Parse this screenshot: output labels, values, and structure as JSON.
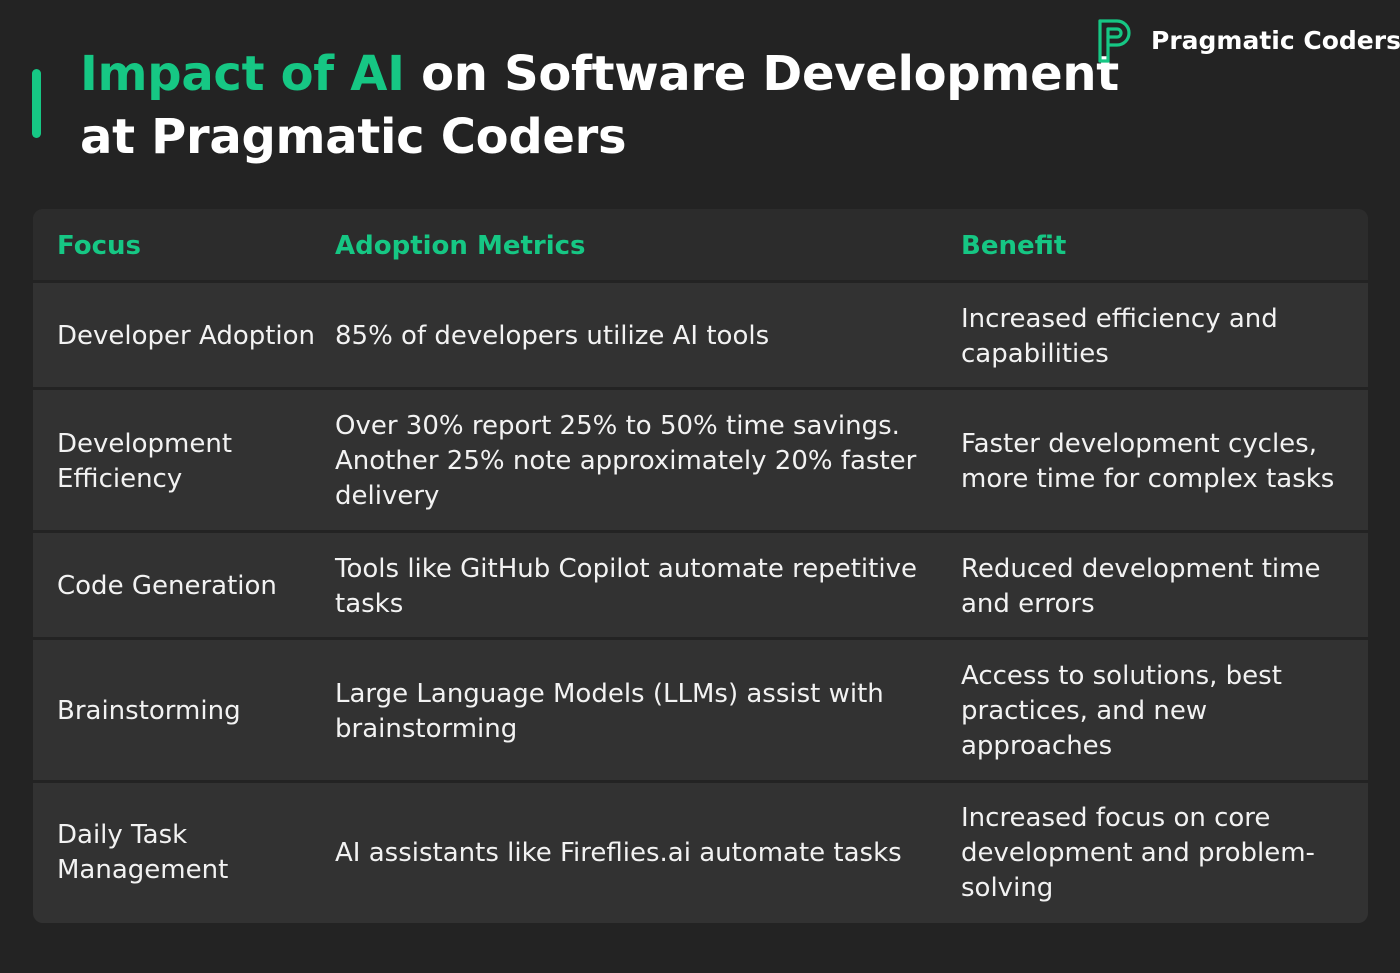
{
  "brand": {
    "name": "Pragmatic Coders",
    "logo_icon": "pc-logo-icon",
    "accent_color": "#16c784"
  },
  "title": {
    "highlight": "Impact of AI",
    "rest_line1": " on Software Development",
    "line2": "at Pragmatic Coders"
  },
  "table": {
    "headers": [
      "Focus",
      "Adoption Metrics",
      "Benefit"
    ],
    "rows": [
      {
        "focus": "Developer Adoption",
        "metrics": "85% of developers utilize AI tools",
        "benefit": "Increased efficiency and capabilities"
      },
      {
        "focus": "Development Efficiency",
        "metrics": "Over 30% report 25% to 50% time savings. Another 25% note approximately 20% faster delivery",
        "benefit": "Faster development cycles, more time for complex tasks"
      },
      {
        "focus": "Code Generation",
        "metrics": "Tools like GitHub Copilot automate repetitive tasks",
        "benefit": "Reduced development time and errors"
      },
      {
        "focus": "Brainstorming",
        "metrics": "Large Language Models (LLMs) assist with brainstorming",
        "benefit": "Access to solutions, best practices, and new approaches"
      },
      {
        "focus": "Daily Task Management",
        "metrics": "AI assistants like Fireflies.ai automate tasks",
        "benefit": "Increased focus on core development and problem-solving"
      }
    ]
  }
}
